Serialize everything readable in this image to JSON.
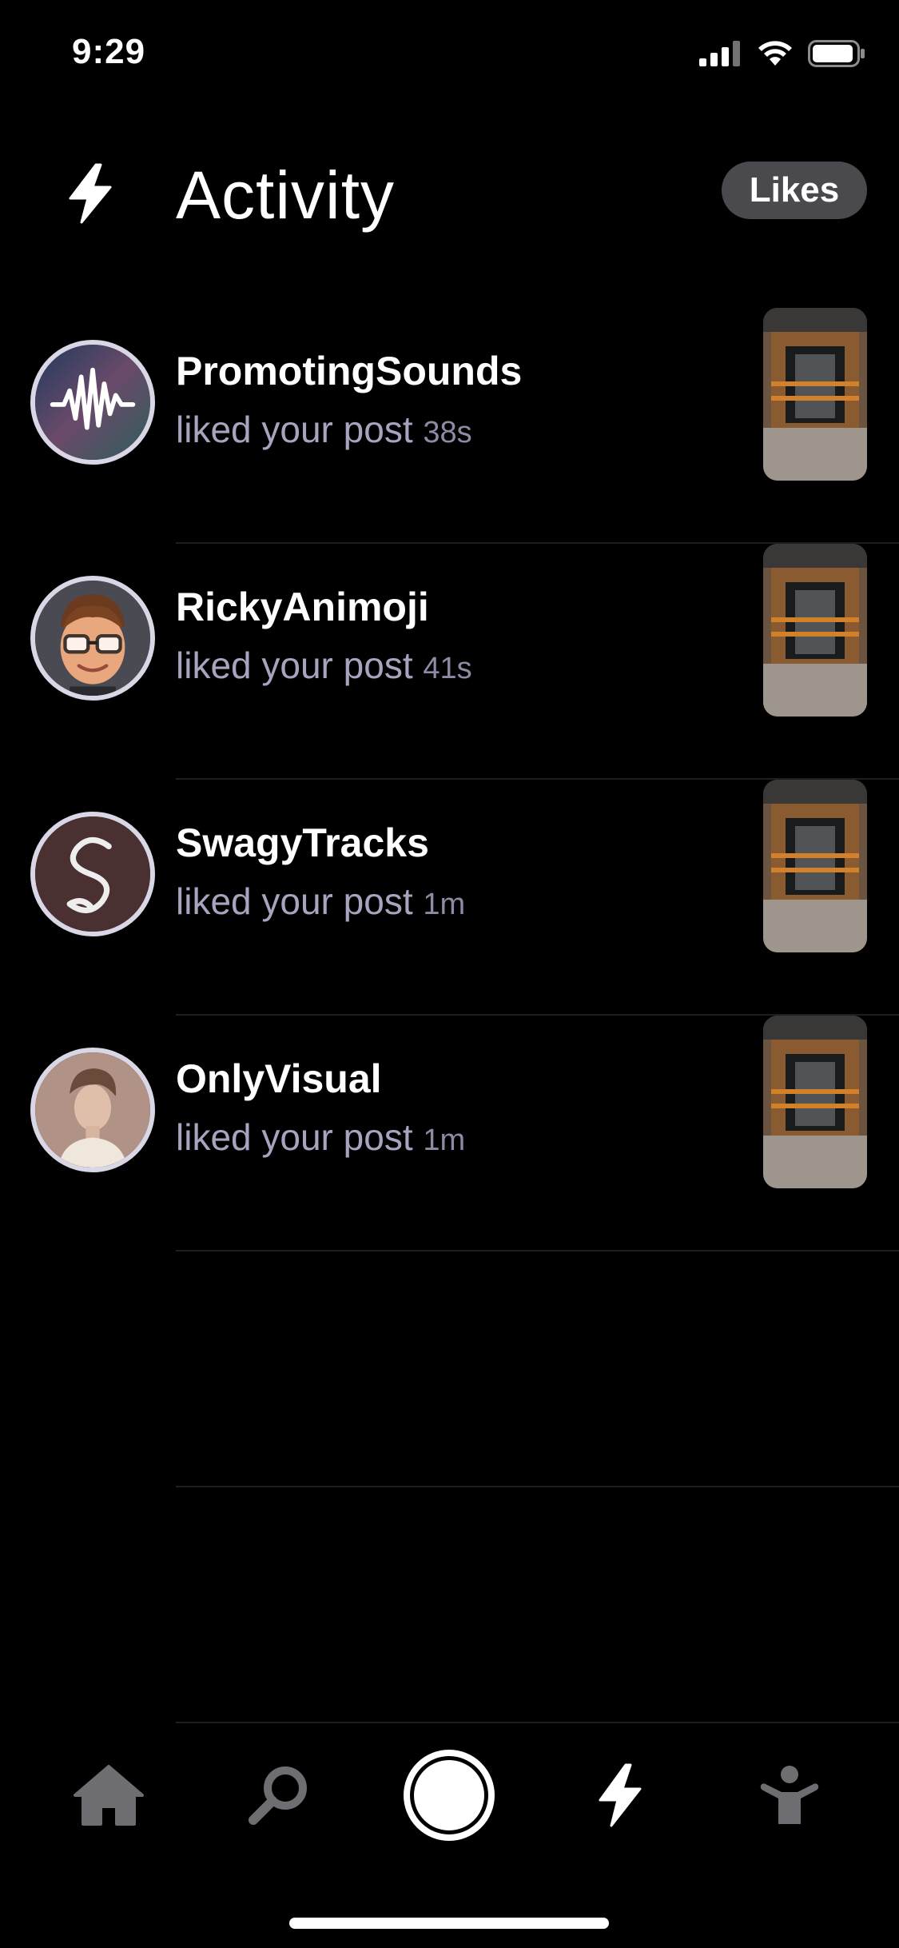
{
  "status_bar": {
    "time": "9:29"
  },
  "header": {
    "title": "Activity",
    "filter_label": "Likes"
  },
  "activity": [
    {
      "username": "PromotingSounds",
      "action": "liked your post",
      "time": "38s"
    },
    {
      "username": "RickyAnimoji",
      "action": "liked your post",
      "time": "41s"
    },
    {
      "username": "SwagyTracks",
      "action": "liked your post",
      "time": "1m"
    },
    {
      "username": "OnlyVisual",
      "action": "liked your post",
      "time": "1m"
    }
  ],
  "tab_bar": {
    "items": [
      "home-icon",
      "search-icon",
      "camera-icon",
      "activity-bolt-icon",
      "profile-icon"
    ],
    "active": "activity-bolt-icon"
  },
  "colors": {
    "background": "#000000",
    "subtext": "#a8a4bf",
    "pill": "#4a4a4e",
    "inactive_tab": "#6e6e72"
  }
}
